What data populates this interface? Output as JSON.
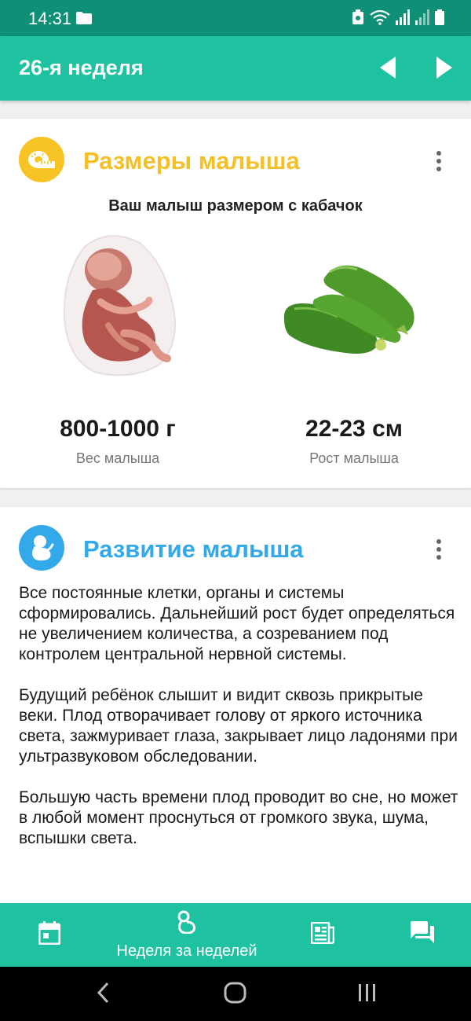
{
  "status_bar": {
    "time": "14:31"
  },
  "app_bar": {
    "title": "26-я неделя"
  },
  "size_card": {
    "title": "Размеры малыша",
    "subtitle": "Ваш малыш размером с кабачок",
    "weight_value": "800-1000 г",
    "weight_label": "Вес малыша",
    "length_value": "22-23 см",
    "length_label": "Рост малыша"
  },
  "development_card": {
    "title": "Развитие малыша",
    "paragraphs": [
      "Все постоянные клетки, органы и системы сформировались. Дальнейший рост будет определяться не увеличением количества, а созреванием под контролем центральной нервной системы.",
      "Будущий ребёнок слышит и видит сквозь прикрытые веки. Плод отворачивает голову от яркого источника света, зажмуривает глаза, закрывает лицо ладонями при ультразвуковом обследовании.",
      "Большую часть времени плод проводит во сне, но может в любой момент проснуться от громкого звука, шума, вспышки света."
    ]
  },
  "bottom_nav": {
    "week_label": "Неделя за неделей"
  },
  "colors": {
    "primary": "#1ec2a0",
    "status": "#0e8f76",
    "size_accent": "#f5bf26",
    "development_accent": "#33a9ea"
  }
}
